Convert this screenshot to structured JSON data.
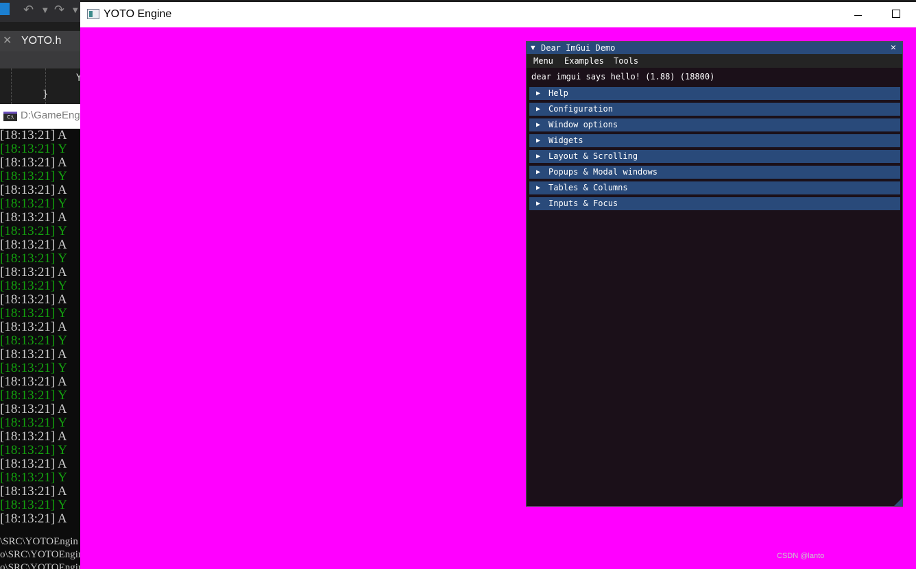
{
  "vs": {
    "tab_close": "✕",
    "tab_label": "YOTO.h",
    "editor_brace": "}",
    "editor_char": "Y"
  },
  "console": {
    "title": "D:\\GameEng",
    "icon_text": "C:\\",
    "lines": [
      {
        "text": "[18:13:21] A",
        "color": "white"
      },
      {
        "text": "[18:13:21] Y",
        "color": "green"
      },
      {
        "text": "[18:13:21] A",
        "color": "white"
      },
      {
        "text": "[18:13:21] Y",
        "color": "green"
      },
      {
        "text": "[18:13:21] A",
        "color": "white"
      },
      {
        "text": "[18:13:21] Y",
        "color": "green"
      },
      {
        "text": "[18:13:21] A",
        "color": "white"
      },
      {
        "text": "[18:13:21] Y",
        "color": "green"
      },
      {
        "text": "[18:13:21] A",
        "color": "white"
      },
      {
        "text": "[18:13:21] Y",
        "color": "green"
      },
      {
        "text": "[18:13:21] A",
        "color": "white"
      },
      {
        "text": "[18:13:21] Y",
        "color": "green"
      },
      {
        "text": "[18:13:21] A",
        "color": "white"
      },
      {
        "text": "[18:13:21] Y",
        "color": "green"
      },
      {
        "text": "[18:13:21] A",
        "color": "white"
      },
      {
        "text": "[18:13:21] Y",
        "color": "green"
      },
      {
        "text": "[18:13:21] A",
        "color": "white"
      },
      {
        "text": "[18:13:21] Y",
        "color": "green"
      },
      {
        "text": "[18:13:21] A",
        "color": "white"
      },
      {
        "text": "[18:13:21] Y",
        "color": "green"
      },
      {
        "text": "[18:13:21] A",
        "color": "white"
      },
      {
        "text": "[18:13:21] Y",
        "color": "green"
      },
      {
        "text": "[18:13:21] A",
        "color": "white"
      },
      {
        "text": "[18:13:21] Y",
        "color": "green"
      },
      {
        "text": "[18:13:21] A",
        "color": "white"
      },
      {
        "text": "[18:13:21] Y",
        "color": "green"
      },
      {
        "text": "[18:13:21] A",
        "color": "white"
      },
      {
        "text": "[18:13:21] Y",
        "color": "green"
      },
      {
        "text": "[18:13:21] A",
        "color": "white"
      }
    ],
    "bottom_lines": [
      "\\SRC\\YOTOEngin",
      "o\\SRC\\YOTOEngin",
      "o\\SRC\\YOTOEngin"
    ]
  },
  "yoto": {
    "title": "YOTO Engine",
    "background": "#ff00ff"
  },
  "imgui": {
    "title": "Dear ImGui Demo",
    "collapse_glyph": "▼",
    "close_glyph": "✕",
    "menu": [
      "Menu",
      "Examples",
      "Tools"
    ],
    "hello": "dear imgui says hello! (1.88) (18800)",
    "headers": [
      "Help",
      "Configuration",
      "Window options",
      "Widgets",
      "Layout & Scrolling",
      "Popups & Modal windows",
      "Tables & Columns",
      "Inputs & Focus"
    ],
    "header_glyph": "▶",
    "colors": {
      "title_bar": "#294a7a",
      "header": "#294a7a",
      "window_bg": "#1b1019",
      "menubar": "#242424"
    }
  },
  "watermark": "CSDN @lanto"
}
